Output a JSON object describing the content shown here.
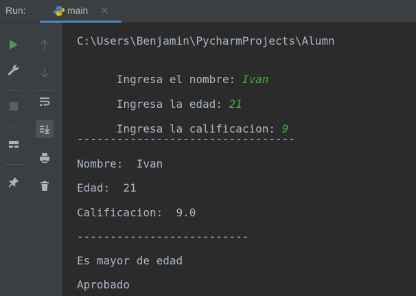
{
  "run_panel": {
    "label": "Run:",
    "tab": {
      "title": "main",
      "close_glyph": "×",
      "icon": "python-icon"
    }
  },
  "toolbar_primary": {
    "icons": [
      "run-icon",
      "wrench-icon",
      "stop-icon",
      "layout-icon",
      "pin-icon"
    ]
  },
  "toolbar_secondary": {
    "icons": [
      "up-arrow-icon",
      "down-arrow-icon",
      "soft-wrap-icon",
      "scroll-to-end-icon",
      "print-icon",
      "trash-icon"
    ]
  },
  "console": {
    "command_line": "C:\\Users\\Benjamin\\PycharmProjects\\Alumn",
    "prompts": [
      {
        "label": "Ingresa el nombre: ",
        "input": "Ivan"
      },
      {
        "label": "Ingresa la edad: ",
        "input": "21"
      },
      {
        "label": "Ingresa la calificacion: ",
        "input": "9"
      }
    ],
    "separator_long": "---------------------------------",
    "results": {
      "nombre": "Nombre:  Ivan",
      "edad": "Edad:  21",
      "calificacion": "Calificacion:  9.0"
    },
    "separator_short": "--------------------------",
    "mayor": "Es mayor de edad",
    "aprobado": "Aprobado"
  },
  "colors": {
    "background": "#2b2b2b",
    "panel": "#3c3f41",
    "text": "#a9b7c6",
    "input": "#46a846",
    "accent": "#4a88c7"
  }
}
